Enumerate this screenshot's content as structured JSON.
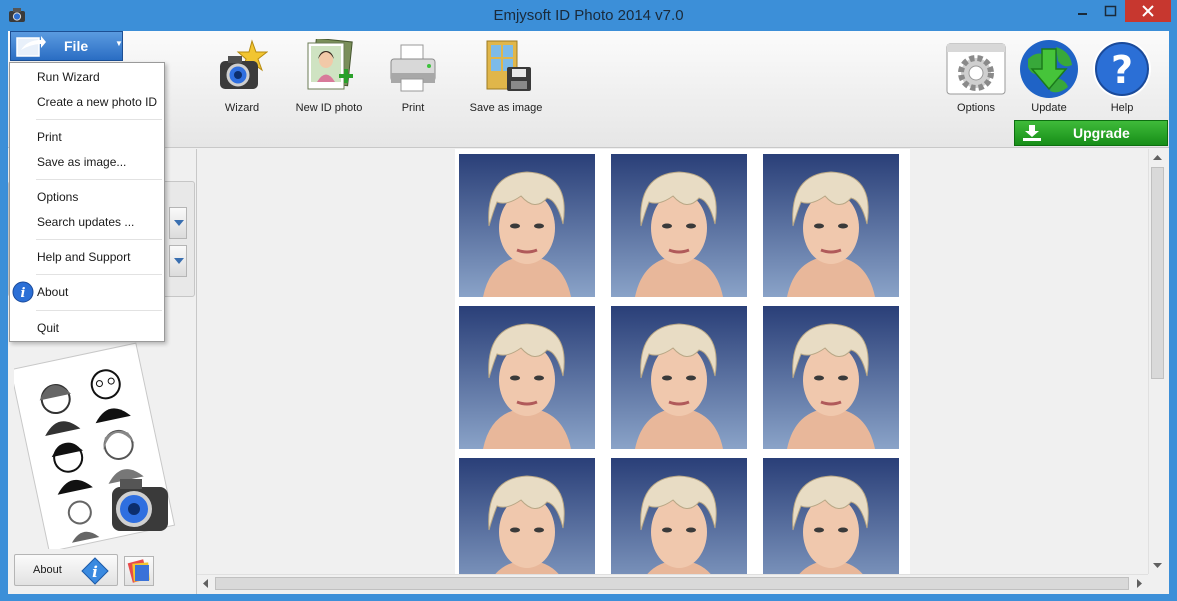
{
  "window": {
    "title": "Emjysoft ID Photo 2014 v7.0"
  },
  "ribbon": {
    "file_label": "File",
    "buttons": {
      "wizard": "Wizard",
      "new_id_photo": "New ID photo",
      "print": "Print",
      "save_as_image": "Save as image",
      "options": "Options",
      "update": "Update",
      "help": "Help"
    },
    "upgrade_label": "Upgrade"
  },
  "file_menu": {
    "items": [
      "Run Wizard",
      "Create a new photo ID",
      "Print",
      "Save as image...",
      "Options",
      "Search updates ...",
      "Help and Support",
      "About",
      "Quit"
    ]
  },
  "left_pane": {
    "about_label": "About"
  },
  "colors": {
    "title_bar": "#3c8fd8",
    "file_button": "#2a6dc3",
    "upgrade_button": "#178e18",
    "close_button": "#c7372f"
  }
}
